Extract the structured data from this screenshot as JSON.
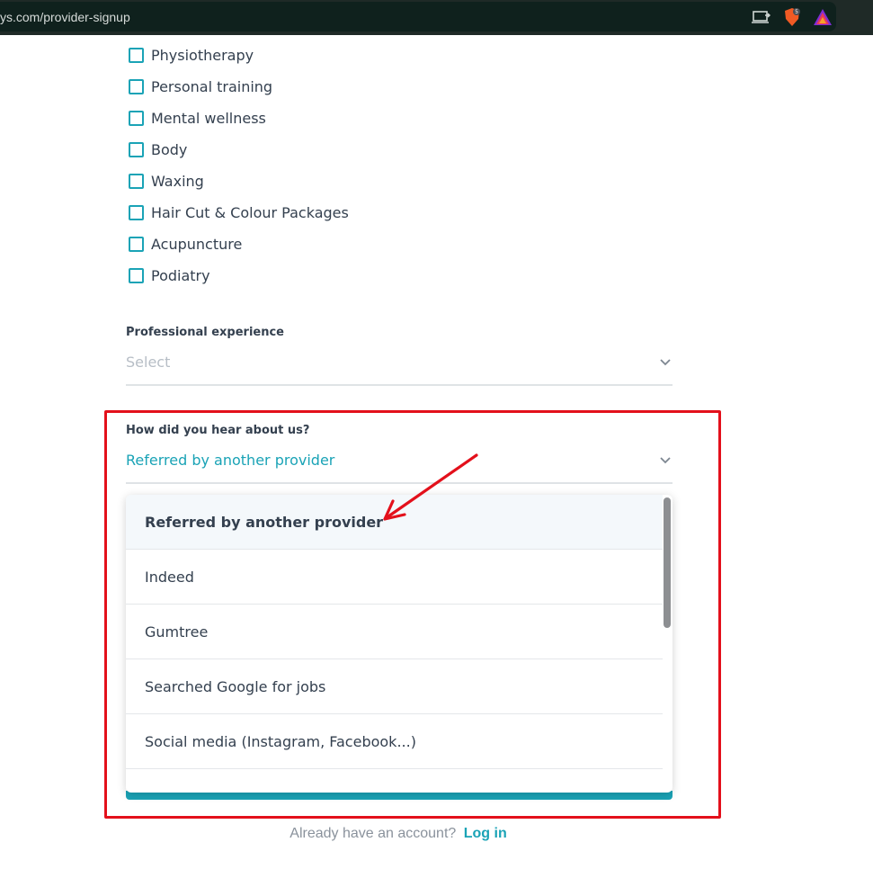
{
  "browser": {
    "url": "ys.com/provider-signup"
  },
  "services": [
    {
      "label": "Physiotherapy"
    },
    {
      "label": "Personal training"
    },
    {
      "label": "Mental wellness"
    },
    {
      "label": "Body"
    },
    {
      "label": "Waxing"
    },
    {
      "label": "Hair Cut & Colour Packages"
    },
    {
      "label": "Acupuncture"
    },
    {
      "label": "Podiatry"
    }
  ],
  "experience": {
    "label": "Professional experience",
    "placeholder": "Select"
  },
  "referral": {
    "label": "How did you hear about us?",
    "value": "Referred by another provider",
    "options": [
      {
        "label": "Referred by another provider"
      },
      {
        "label": "Indeed"
      },
      {
        "label": "Gumtree"
      },
      {
        "label": "Searched Google for jobs"
      },
      {
        "label": "Social media (Instagram, Facebook...)"
      }
    ]
  },
  "login": {
    "prompt": "Already have an account?",
    "link": "Log in"
  },
  "colors": {
    "accent": "#1aa3b6",
    "annotation": "#e3101b"
  }
}
